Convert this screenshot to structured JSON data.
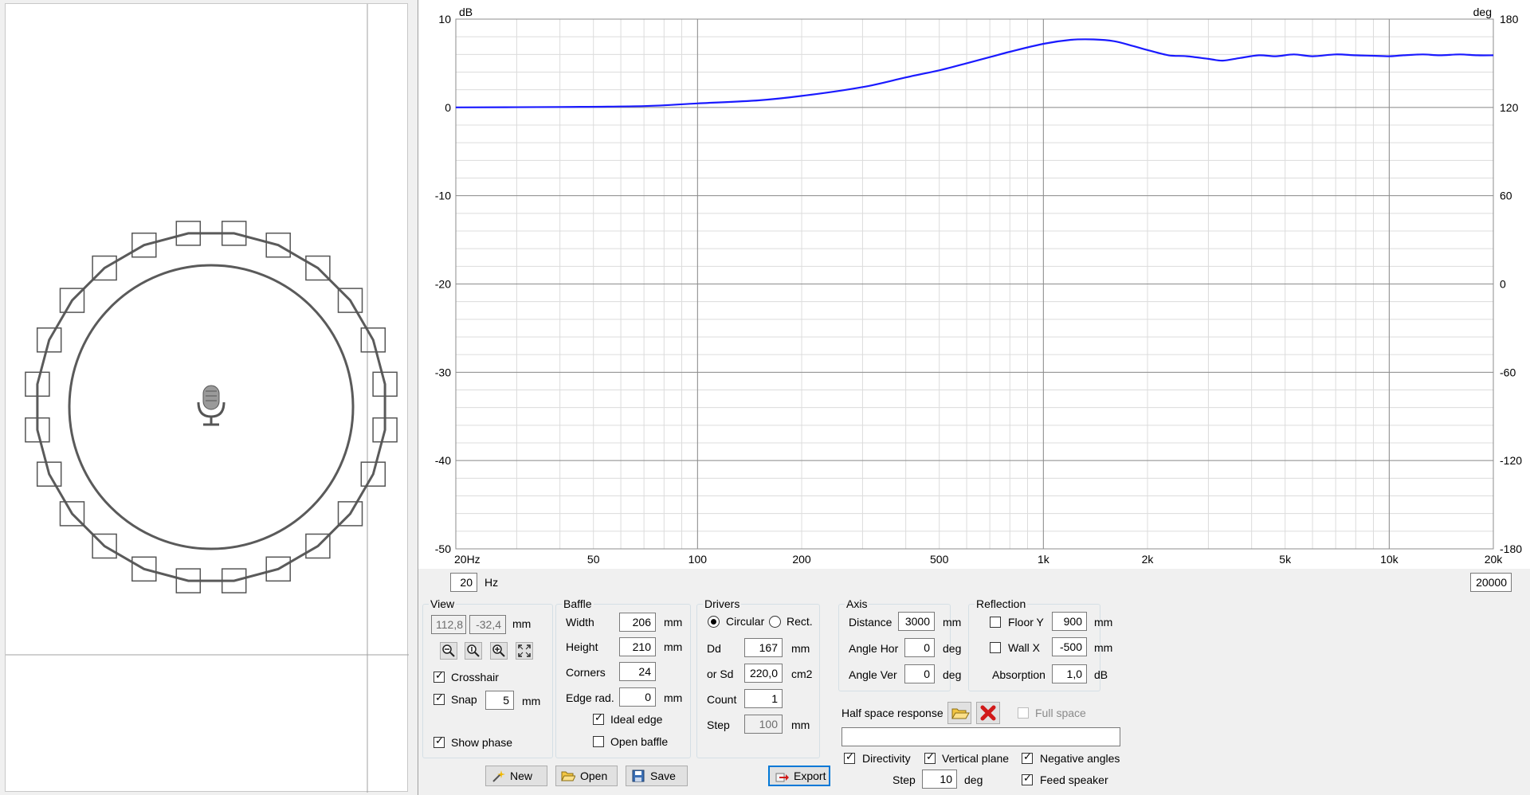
{
  "chart_data": {
    "type": "line",
    "title": "",
    "xlabel": "",
    "ylabel": "dB",
    "y2label": "deg",
    "x_scale": "log",
    "xlim": [
      20,
      20000
    ],
    "ylim": [
      -50,
      10
    ],
    "y2lim": [
      -180,
      180
    ],
    "grid": true,
    "x_tick_values": [
      20,
      50,
      100,
      200,
      500,
      1000,
      2000,
      5000,
      10000,
      20000
    ],
    "x_tick_labels": [
      "20Hz",
      "50",
      "100",
      "200",
      "500",
      "1k",
      "2k",
      "5k",
      "10k",
      "20k"
    ],
    "y_ticks": [
      10,
      0,
      -10,
      -20,
      -30,
      -40,
      -50
    ],
    "y2_ticks": [
      180,
      120,
      60,
      0,
      -60,
      -120,
      -180
    ],
    "series": [
      {
        "color": "#1a1aff",
        "points": [
          [
            20,
            0.0
          ],
          [
            40,
            0.05
          ],
          [
            70,
            0.15
          ],
          [
            100,
            0.45
          ],
          [
            150,
            0.8
          ],
          [
            200,
            1.3
          ],
          [
            300,
            2.3
          ],
          [
            400,
            3.4
          ],
          [
            500,
            4.2
          ],
          [
            600,
            5.0
          ],
          [
            700,
            5.7
          ],
          [
            800,
            6.3
          ],
          [
            1000,
            7.2
          ],
          [
            1200,
            7.65
          ],
          [
            1400,
            7.7
          ],
          [
            1600,
            7.5
          ],
          [
            1800,
            7.0
          ],
          [
            2000,
            6.5
          ],
          [
            2300,
            5.9
          ],
          [
            2600,
            5.8
          ],
          [
            3000,
            5.5
          ],
          [
            3300,
            5.3
          ],
          [
            3700,
            5.6
          ],
          [
            4200,
            5.9
          ],
          [
            4700,
            5.8
          ],
          [
            5300,
            6.0
          ],
          [
            6000,
            5.8
          ],
          [
            7000,
            6.0
          ],
          [
            8000,
            5.9
          ],
          [
            9000,
            5.85
          ],
          [
            10000,
            5.8
          ],
          [
            11000,
            5.9
          ],
          [
            12500,
            6.0
          ],
          [
            14000,
            5.9
          ],
          [
            16000,
            6.0
          ],
          [
            18000,
            5.9
          ],
          [
            20000,
            5.9
          ]
        ]
      }
    ]
  },
  "range": {
    "min_value": "20",
    "min_unit": "Hz",
    "max_value": "20000"
  },
  "view": {
    "title": "View",
    "x": "112,8",
    "y": "-32,4",
    "unit": "mm",
    "crosshair_label": "Crosshair",
    "crosshair_checked": true,
    "snap_label": "Snap",
    "snap_checked": true,
    "snap_value": "5",
    "snap_unit": "mm",
    "show_phase_label": "Show phase",
    "show_phase_checked": true,
    "tool_icons": [
      "zoom-out-icon",
      "zoom-fit-icon",
      "zoom-in-icon",
      "expand-icon"
    ]
  },
  "baffle": {
    "title": "Baffle",
    "width_label": "Width",
    "width_value": "206",
    "width_unit": "mm",
    "height_label": "Height",
    "height_value": "210",
    "height_unit": "mm",
    "corners_label": "Corners",
    "corners_value": "24",
    "edge_label": "Edge rad.",
    "edge_value": "0",
    "edge_unit": "mm",
    "ideal_edge_label": "Ideal edge",
    "ideal_edge_checked": true,
    "open_baffle_label": "Open baffle",
    "open_baffle_checked": false
  },
  "drivers": {
    "title": "Drivers",
    "circular_label": "Circular",
    "circular_selected": true,
    "rect_label": "Rect.",
    "dd_label": "Dd",
    "dd_value": "167",
    "dd_unit": "mm",
    "sd_label": "or Sd",
    "sd_value": "220,0",
    "sd_unit": "cm2",
    "count_label": "Count",
    "count_value": "1",
    "step_label": "Step",
    "step_value": "100",
    "step_unit": "mm"
  },
  "axis": {
    "title": "Axis",
    "distance_label": "Distance",
    "distance_value": "3000",
    "distance_unit": "mm",
    "hor_label": "Angle Hor",
    "hor_value": "0",
    "hor_unit": "deg",
    "ver_label": "Angle Ver",
    "ver_value": "0",
    "ver_unit": "deg"
  },
  "reflection": {
    "title": "Reflection",
    "floor_label": "Floor Y",
    "floor_value": "900",
    "floor_unit": "mm",
    "floor_checked": false,
    "wall_label": "Wall  X",
    "wall_value": "-500",
    "wall_unit": "mm",
    "wall_checked": false,
    "absorption_label": "Absorption",
    "absorption_value": "1,0",
    "absorption_unit": "dB"
  },
  "half_space": {
    "label": "Half space response",
    "full_space_label": "Full space",
    "full_space_checked": false,
    "path_value": ""
  },
  "directivity": {
    "directivity_label": "Directivity",
    "directivity_checked": true,
    "vertical_label": "Vertical plane",
    "vertical_checked": true,
    "negative_label": "Negative angles",
    "negative_checked": true,
    "step_label": "Step",
    "step_value": "10",
    "step_unit": "deg",
    "feed_label": "Feed speaker",
    "feed_checked": true
  },
  "buttons": {
    "new": "New",
    "open": "Open",
    "save": "Save",
    "export": "Export"
  },
  "baffle_view": {
    "outline_color": "#5a5a5a",
    "handle_count": 24,
    "center_icon": "microphone-icon"
  }
}
